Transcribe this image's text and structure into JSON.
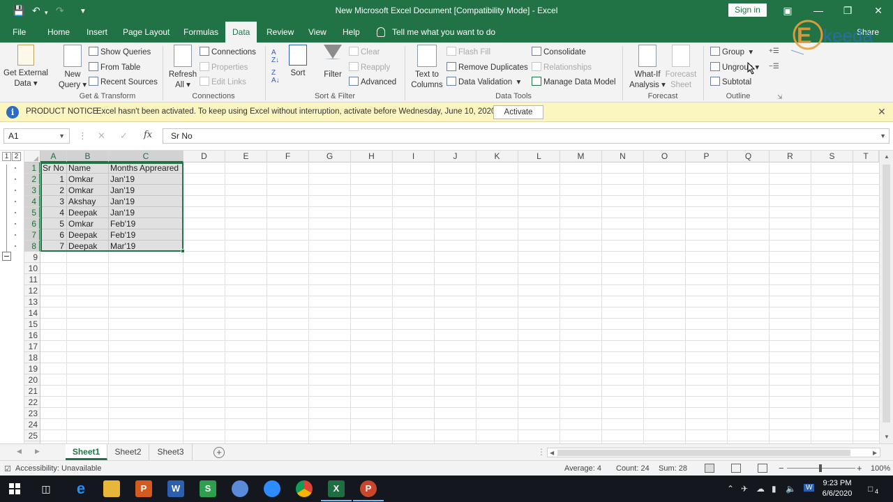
{
  "window": {
    "title": "New Microsoft Excel Document  [Compatibility Mode]  -  Excel",
    "signin_label": "Sign in",
    "share_label": "Share"
  },
  "ribbon_tabs": [
    "File",
    "Home",
    "Insert",
    "Page Layout",
    "Formulas",
    "Data",
    "Review",
    "View",
    "Help"
  ],
  "active_tab": "Data",
  "tell_me": "Tell me what you want to do",
  "ribbon": {
    "get_external_data": [
      "Get External",
      "Data"
    ],
    "new_query": [
      "New",
      "Query"
    ],
    "show_queries": "Show Queries",
    "from_table": "From Table",
    "recent_sources": "Recent Sources",
    "refresh_all": [
      "Refresh",
      "All"
    ],
    "connections": "Connections",
    "properties": "Properties",
    "edit_links": "Edit Links",
    "sort": "Sort",
    "filter": "Filter",
    "clear": "Clear",
    "reapply": "Reapply",
    "advanced": "Advanced",
    "text_to_columns": [
      "Text to",
      "Columns"
    ],
    "flash_fill": "Flash Fill",
    "remove_duplicates": "Remove Duplicates",
    "data_validation": "Data Validation",
    "consolidate": "Consolidate",
    "relationships": "Relationships",
    "manage_data_model": "Manage Data Model",
    "what_if": [
      "What-If",
      "Analysis"
    ],
    "forecast_sheet": [
      "Forecast",
      "Sheet"
    ],
    "group": "Group",
    "ungroup": "Ungroup",
    "subtotal": "Subtotal",
    "groups": [
      "Get & Transform",
      "Connections",
      "Sort & Filter",
      "Data Tools",
      "Forecast",
      "Outline"
    ]
  },
  "notice": {
    "title": "PRODUCT NOTICE",
    "message": "Excel hasn't been activated. To keep using Excel without interruption, activate before Wednesday, June 10, 2020.",
    "button": "Activate"
  },
  "formula_bar": {
    "name_box": "A1",
    "formula": "Sr No"
  },
  "outline_levels": [
    "1",
    "2"
  ],
  "columns": [
    "A",
    "B",
    "C",
    "D",
    "E",
    "F",
    "G",
    "H",
    "I",
    "J",
    "K",
    "L",
    "M",
    "N",
    "O",
    "P",
    "Q",
    "R",
    "S",
    "T"
  ],
  "rows": [
    "1",
    "2",
    "3",
    "4",
    "5",
    "6",
    "7",
    "8",
    "9",
    "10",
    "11",
    "12",
    "13",
    "14",
    "15",
    "16",
    "17",
    "18",
    "19",
    "20",
    "21",
    "22",
    "23",
    "24",
    "25"
  ],
  "table": {
    "headers": [
      "Sr No",
      "Name",
      "Months Appreared"
    ],
    "rows": [
      [
        "1",
        "Omkar",
        "Jan'19"
      ],
      [
        "2",
        "Omkar",
        "Jan'19"
      ],
      [
        "3",
        "Akshay",
        "Jan'19"
      ],
      [
        "4",
        "Deepak",
        "Jan'19"
      ],
      [
        "5",
        "Omkar",
        "Feb'19"
      ],
      [
        "6",
        "Deepak",
        "Feb'19"
      ],
      [
        "7",
        "Deepak",
        "Mar'19"
      ]
    ]
  },
  "sheets": [
    "Sheet1",
    "Sheet2",
    "Sheet3"
  ],
  "active_sheet": "Sheet1",
  "status": {
    "accessibility": "Accessibility: Unavailable",
    "average": "Average: 4",
    "count": "Count: 24",
    "sum": "Sum: 28",
    "zoom": "100%"
  },
  "taskbar": {
    "time": "9:23 PM",
    "date": "6/6/2020",
    "notifications": "4"
  },
  "watermark": "Ekeeda",
  "colors": {
    "excel_green": "#217346",
    "notice_bg": "#fbf6c0"
  }
}
